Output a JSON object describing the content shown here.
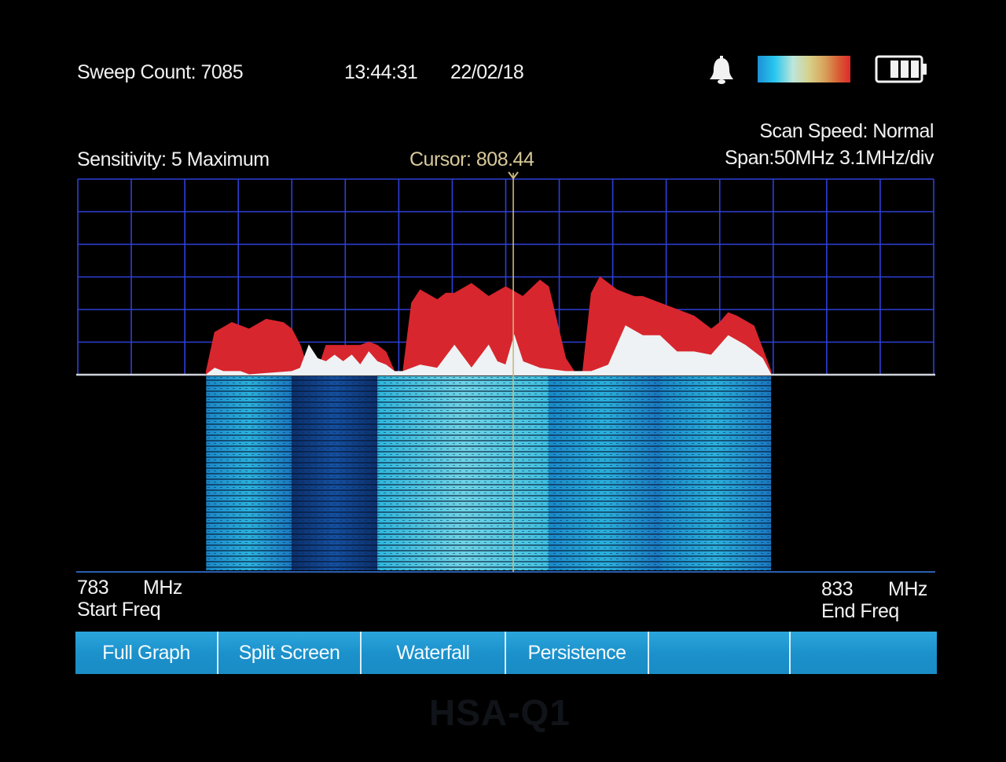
{
  "status": {
    "sweep_count": "Sweep Count: 7085",
    "time": "13:44:31",
    "date": "22/02/18"
  },
  "settings": {
    "sensitivity": "Sensitivity: 5 Maximum",
    "cursor": "Cursor: 808.44",
    "scan_speed": "Scan Speed: Normal",
    "span": "Span:50MHz 3.1MHz/div"
  },
  "icons": {
    "alarm": "bell-icon",
    "scale": "color-scale-icon",
    "battery": "battery-icon",
    "battery_level": 0.75
  },
  "frequency": {
    "start_value": "783",
    "start_unit": "MHz",
    "start_label": "Start Freq",
    "end_value": "833",
    "end_unit": "MHz",
    "end_label": "End Freq"
  },
  "menu": [
    {
      "label": "Full Graph"
    },
    {
      "label": "Split Screen"
    },
    {
      "label": "Waterfall"
    },
    {
      "label": "Persistence"
    },
    {
      "label": ""
    },
    {
      "label": ""
    }
  ],
  "brand": {
    "model": "HSA-Q1"
  },
  "colors": {
    "grid": "#2f3fd8",
    "peak": "#d8262e",
    "average": "#eef2f4",
    "cursor": "#c9b77a",
    "menu": "#1e95cf",
    "waterfall_dark": "#0a1f4a",
    "waterfall_mid": "#1a68b8",
    "waterfall_light": "#3fc0e0"
  },
  "chart_data": {
    "type": "area",
    "xlim": [
      783,
      833
    ],
    "x_unit": "MHz",
    "divisions_x": 16,
    "divisions_y": 6,
    "cursor_freq": 808.44,
    "ylim": [
      0,
      6
    ],
    "series": [
      {
        "name": "",
        "x": [
          790.5,
          791.0,
          792.0,
          793.0,
          794.0,
          795.0,
          795.5,
          796.0,
          796.5,
          797.0,
          797.5,
          798.5,
          799.5,
          800.0,
          800.5,
          801.0,
          801.5,
          802.0,
          802.5,
          803.0,
          804.0,
          804.5,
          805.0,
          806.0,
          807.0,
          808.0,
          809.0,
          810.0,
          810.5,
          811.5,
          812.0,
          812.5,
          813.0,
          813.5,
          814.0,
          814.5,
          815.0,
          815.5,
          816.0,
          817.0,
          818.0,
          819.0,
          820.0,
          820.5,
          821.0,
          821.5,
          822.5,
          823.0,
          823.5
        ],
        "values": [
          0.1,
          1.3,
          1.6,
          1.4,
          1.7,
          1.6,
          1.4,
          0.9,
          0.1,
          0.1,
          0.9,
          0.9,
          0.9,
          1.0,
          0.9,
          0.7,
          0.1,
          0.1,
          2.2,
          2.6,
          2.3,
          2.5,
          2.5,
          2.8,
          2.4,
          2.7,
          2.4,
          2.9,
          2.7,
          0.5,
          0.1,
          0.1,
          2.5,
          3.0,
          2.8,
          2.6,
          2.5,
          2.4,
          2.4,
          2.2,
          2.0,
          1.8,
          1.4,
          1.6,
          1.9,
          1.8,
          1.5,
          0.8,
          0.1
        ]
      },
      {
        "name": "",
        "x": [
          790.5,
          791.0,
          791.5,
          792.0,
          792.5,
          793.0,
          795.5,
          796.0,
          796.5,
          797.0,
          797.5,
          798.0,
          798.5,
          799.0,
          799.5,
          800.0,
          800.5,
          801.0,
          801.5,
          802.0,
          803.0,
          804.0,
          805.0,
          806.0,
          807.0,
          807.5,
          808.0,
          808.5,
          809.0,
          810.0,
          811.5,
          812.0,
          813.0,
          814.0,
          815.0,
          816.0,
          817.0,
          818.0,
          819.0,
          820.0,
          821.0,
          822.0,
          823.0,
          823.5
        ],
        "values": [
          0.0,
          0.2,
          0.1,
          0.1,
          0.1,
          0.0,
          0.1,
          0.2,
          0.9,
          0.5,
          0.4,
          0.6,
          0.4,
          0.6,
          0.3,
          0.7,
          0.4,
          0.3,
          0.1,
          0.1,
          0.3,
          0.2,
          0.9,
          0.2,
          0.9,
          0.4,
          0.3,
          1.2,
          0.4,
          0.2,
          0.1,
          0.1,
          0.1,
          0.3,
          1.5,
          1.2,
          1.2,
          0.7,
          0.7,
          0.6,
          1.2,
          0.9,
          0.5,
          0.0
        ]
      }
    ],
    "waterfall_bands": [
      {
        "from": 790.5,
        "to": 795.5,
        "shade": "mid"
      },
      {
        "from": 795.5,
        "to": 800.5,
        "shade": "dark"
      },
      {
        "from": 800.5,
        "to": 810.5,
        "shade": "light"
      },
      {
        "from": 810.5,
        "to": 817.0,
        "shade": "mid"
      },
      {
        "from": 817.0,
        "to": 823.5,
        "shade": "mid"
      }
    ]
  }
}
